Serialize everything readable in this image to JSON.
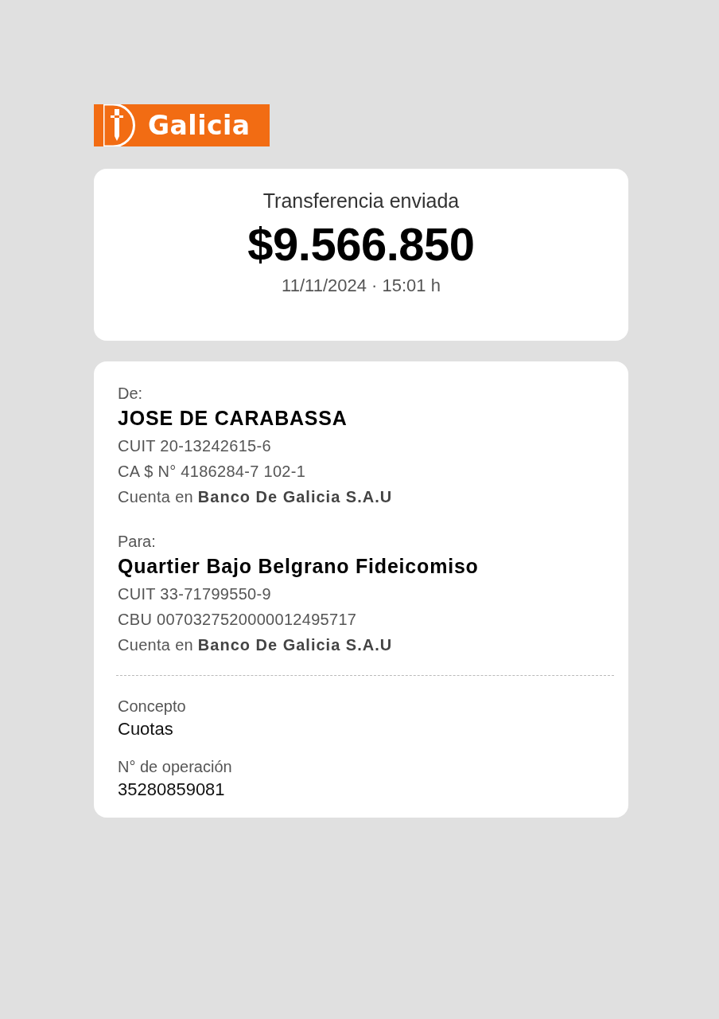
{
  "logo": {
    "text": "Galicia"
  },
  "summary": {
    "title": "Transferencia enviada",
    "amount": "$9.566.850",
    "datetime": "11/11/2024 · 15:01 h"
  },
  "parties": [
    {
      "label": "De:",
      "name": "JOSE DE CARABASSA",
      "lines": [
        "CUIT 20-13242615-6",
        "CA $ N° 4186284-7 102-1",
        "Cuenta en **Banco De Galicia S.A.U**"
      ]
    },
    {
      "label": "Para:",
      "name": "Quartier Bajo Belgrano Fideicomiso",
      "lines": [
        "CUIT 33-71799550-9",
        "CBU 0070327520000012495717",
        "Cuenta en **Banco De Galicia S.A.U**"
      ]
    }
  ],
  "details": [
    {
      "label": "Concepto",
      "value": "Cuotas"
    },
    {
      "label": "N° de operación",
      "value": "35280859081"
    }
  ]
}
